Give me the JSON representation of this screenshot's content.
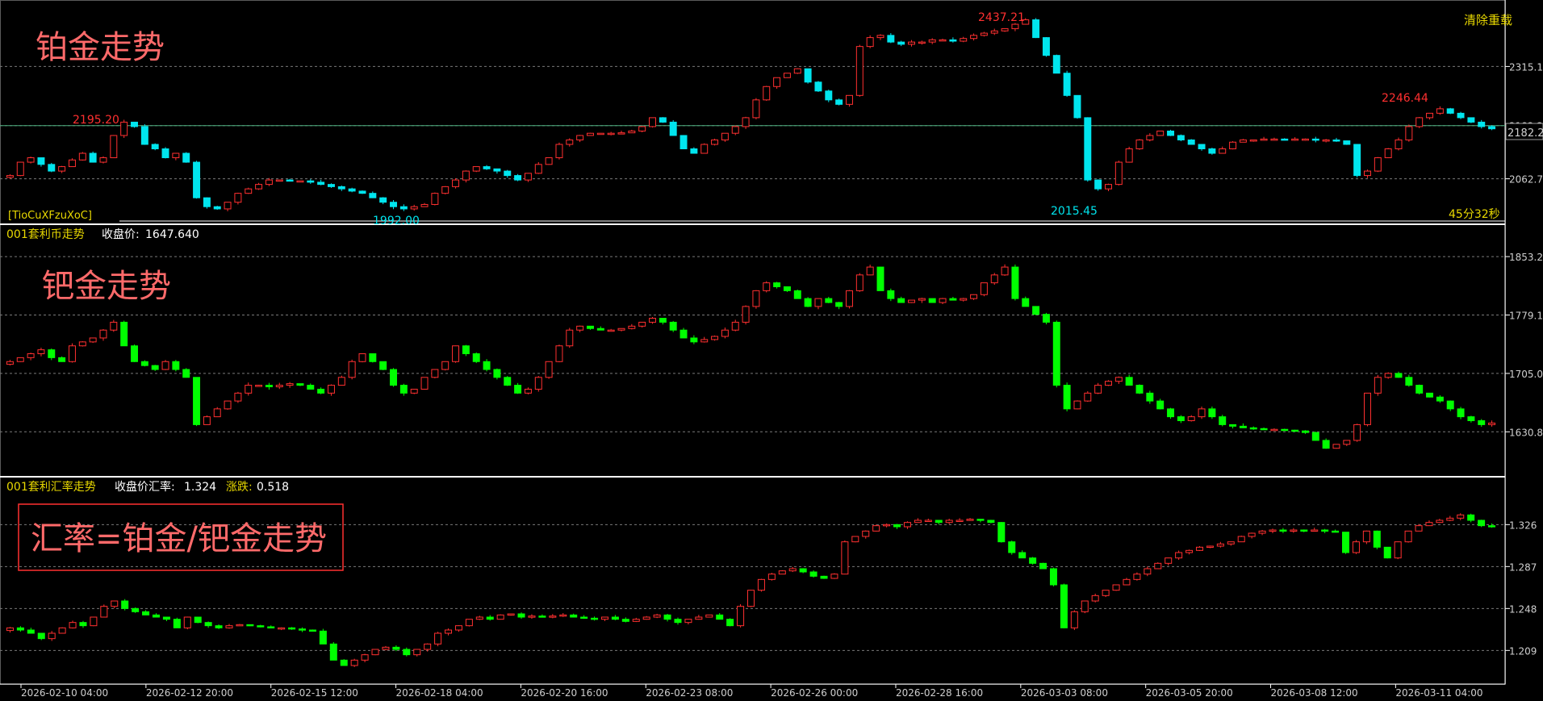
{
  "top_right_button": "清除重载",
  "colors": {
    "background": "#000000",
    "up": "#ff3030",
    "down": "#00e5ee",
    "down_mid": "#00ff00",
    "border": "#ffffff",
    "grid": "#7a7a7a",
    "label_yellow": "#e8d800",
    "annotation_red": "#ff6a6a"
  },
  "panels": [
    {
      "name": "platinum",
      "overlay_title": "铂金走势",
      "code_label": "[TioCuXFzuXoC]",
      "countdown": "45分32秒",
      "current_price": "2182.20",
      "high_marker": "2437.21",
      "local_high_marker_1": "2195.20",
      "local_high_marker_2": "2246.44",
      "low_marker_1": "1992.00",
      "low_marker_2": "2015.45"
    },
    {
      "name": "palladium",
      "overlay_title": "钯金走势",
      "header_name": "001套利币走势",
      "header_close_label": "收盘价:",
      "header_close_value": "1647.640"
    },
    {
      "name": "ratio",
      "overlay_title": "汇率=铂金/钯金走势",
      "header_name": "001套利汇率走势",
      "header_close_label": "收盘价汇率:",
      "header_close_value": "1.324",
      "header_change_label": "涨跌:",
      "header_change_value": "0.518"
    }
  ],
  "chart_data": [
    {
      "type": "candlestick",
      "title": "铂金走势",
      "y_ticks": [
        2062.7,
        2182.2,
        2315.1
      ],
      "ylim": [
        1975,
        2450
      ],
      "close": [
        2070,
        2100,
        2110,
        2095,
        2080,
        2090,
        2105,
        2120,
        2100,
        2110,
        2160,
        2190,
        2180,
        2140,
        2130,
        2110,
        2120,
        2100,
        2020,
        2000,
        1995,
        2010,
        2030,
        2040,
        2050,
        2060,
        2060,
        2058,
        2058,
        2055,
        2050,
        2045,
        2040,
        2035,
        2030,
        2020,
        2010,
        2000,
        1995,
        2000,
        2005,
        2030,
        2045,
        2060,
        2080,
        2090,
        2085,
        2080,
        2070,
        2060,
        2075,
        2095,
        2110,
        2140,
        2150,
        2160,
        2165,
        2165,
        2165,
        2166,
        2170,
        2180,
        2200,
        2190,
        2160,
        2130,
        2120,
        2140,
        2150,
        2165,
        2180,
        2200,
        2240,
        2270,
        2290,
        2300,
        2310,
        2280,
        2260,
        2240,
        2230,
        2250,
        2360,
        2380,
        2385,
        2370,
        2365,
        2370,
        2370,
        2375,
        2375,
        2372,
        2378,
        2385,
        2390,
        2395,
        2400,
        2410,
        2420,
        2380,
        2340,
        2300,
        2250,
        2200,
        2060,
        2040,
        2050,
        2100,
        2130,
        2150,
        2160,
        2170,
        2160,
        2150,
        2140,
        2130,
        2120,
        2130,
        2145,
        2150,
        2150,
        2152,
        2152,
        2151,
        2152,
        2152,
        2150,
        2150,
        2148,
        2140,
        2070,
        2080,
        2110,
        2130,
        2150,
        2180,
        2200,
        2210,
        2220,
        2210,
        2200,
        2190,
        2180,
        2175
      ],
      "high_value": 2437.21,
      "low_value": 1992.0,
      "markers": [
        2195.2,
        2246.44,
        2015.45
      ]
    },
    {
      "type": "candlestick",
      "title": "钯金走势",
      "y_ticks": [
        1630.88,
        1705.01,
        1779.14,
        1853.27
      ],
      "ylim": [
        1580,
        1880
      ],
      "close": [
        1720,
        1725,
        1730,
        1735,
        1725,
        1720,
        1740,
        1745,
        1750,
        1760,
        1770,
        1740,
        1720,
        1715,
        1710,
        1720,
        1710,
        1700,
        1640,
        1650,
        1660,
        1670,
        1680,
        1690,
        1690,
        1688,
        1690,
        1692,
        1690,
        1685,
        1680,
        1690,
        1700,
        1720,
        1730,
        1720,
        1710,
        1690,
        1680,
        1685,
        1700,
        1710,
        1720,
        1740,
        1730,
        1720,
        1710,
        1700,
        1690,
        1680,
        1685,
        1700,
        1720,
        1740,
        1760,
        1765,
        1762,
        1760,
        1760,
        1762,
        1765,
        1770,
        1775,
        1770,
        1760,
        1750,
        1745,
        1748,
        1752,
        1760,
        1770,
        1790,
        1810,
        1820,
        1815,
        1810,
        1800,
        1790,
        1800,
        1795,
        1790,
        1810,
        1830,
        1840,
        1810,
        1800,
        1795,
        1798,
        1800,
        1795,
        1800,
        1798,
        1800,
        1805,
        1820,
        1830,
        1840,
        1800,
        1790,
        1780,
        1770,
        1690,
        1660,
        1670,
        1680,
        1690,
        1695,
        1700,
        1690,
        1680,
        1670,
        1660,
        1650,
        1645,
        1650,
        1660,
        1650,
        1640,
        1638,
        1636,
        1635,
        1634,
        1634,
        1633,
        1632,
        1630,
        1620,
        1610,
        1615,
        1620,
        1640,
        1680,
        1700,
        1705,
        1700,
        1690,
        1680,
        1675,
        1670,
        1660,
        1650,
        1645,
        1640,
        1642
      ],
      "close_value": 1647.64
    },
    {
      "type": "candlestick",
      "title": "汇率=铂金/钯金走势",
      "y_ticks": [
        1.209,
        1.248,
        1.287,
        1.326
      ],
      "ylim": [
        1.18,
        1.36
      ],
      "close": [
        1.23,
        1.228,
        1.225,
        1.22,
        1.225,
        1.23,
        1.235,
        1.232,
        1.24,
        1.25,
        1.255,
        1.248,
        1.245,
        1.242,
        1.24,
        1.238,
        1.23,
        1.24,
        1.235,
        1.232,
        1.23,
        1.232,
        1.233,
        1.232,
        1.231,
        1.23,
        1.23,
        1.229,
        1.228,
        1.227,
        1.215,
        1.2,
        1.195,
        1.2,
        1.205,
        1.21,
        1.212,
        1.21,
        1.205,
        1.21,
        1.215,
        1.225,
        1.228,
        1.232,
        1.238,
        1.24,
        1.238,
        1.242,
        1.243,
        1.24,
        1.241,
        1.24,
        1.241,
        1.242,
        1.24,
        1.239,
        1.238,
        1.24,
        1.238,
        1.236,
        1.238,
        1.24,
        1.242,
        1.238,
        1.235,
        1.238,
        1.24,
        1.242,
        1.238,
        1.232,
        1.25,
        1.265,
        1.275,
        1.28,
        1.283,
        1.285,
        1.282,
        1.278,
        1.276,
        1.28,
        1.31,
        1.315,
        1.32,
        1.325,
        1.326,
        1.324,
        1.328,
        1.33,
        1.33,
        1.328,
        1.33,
        1.33,
        1.331,
        1.33,
        1.328,
        1.31,
        1.3,
        1.295,
        1.29,
        1.285,
        1.27,
        1.23,
        1.245,
        1.255,
        1.26,
        1.265,
        1.27,
        1.275,
        1.28,
        1.285,
        1.29,
        1.295,
        1.3,
        1.302,
        1.305,
        1.306,
        1.308,
        1.31,
        1.315,
        1.318,
        1.32,
        1.321,
        1.32,
        1.321,
        1.32,
        1.321,
        1.32,
        1.319,
        1.3,
        1.31,
        1.32,
        1.305,
        1.295,
        1.31,
        1.32,
        1.325,
        1.328,
        1.33,
        1.332,
        1.335,
        1.33,
        1.325,
        1.324
      ],
      "close_value": 1.324,
      "change": 0.518
    }
  ],
  "x_axis_labels": [
    "2026-02-10 04:00",
    "2026-02-12 20:00",
    "2026-02-15 12:00",
    "2026-02-18 04:00",
    "2026-02-20 16:00",
    "2026-02-23 08:00",
    "2026-02-26 00:00",
    "2026-02-28 16:00",
    "2026-03-03 08:00",
    "2026-03-05 20:00",
    "2026-03-08 12:00",
    "2026-03-11 04:00"
  ]
}
